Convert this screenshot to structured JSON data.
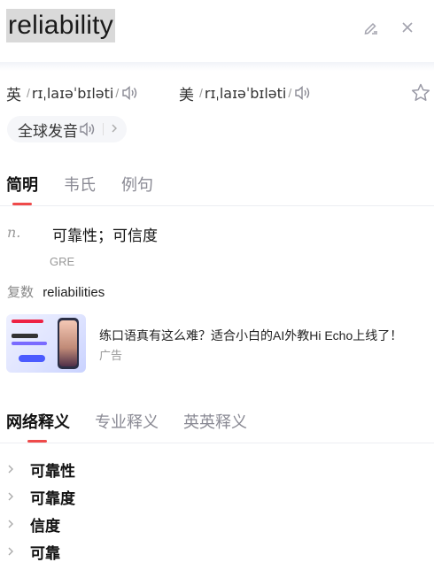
{
  "header": {
    "word": "reliability"
  },
  "phonetics": {
    "uk": {
      "label": "英",
      "ipa": "rɪˌlaɪəˈbɪləti"
    },
    "us": {
      "label": "美",
      "ipa": "rɪˌlaɪəˈbɪləti"
    },
    "global_label": "全球发音"
  },
  "tabs_primary": [
    "简明",
    "韦氏",
    "例句"
  ],
  "definition": {
    "pos": "n.",
    "meaning": "可靠性；可信度",
    "tag": "GRE",
    "plural_label": "复数",
    "plural_value": "reliabilities"
  },
  "ad": {
    "title": "练口语真有这么难？适合小白的AI外教Hi Echo上线了！",
    "label": "广告"
  },
  "tabs_secondary": [
    "网络释义",
    "专业释义",
    "英英释义"
  ],
  "net_definitions": [
    "可靠性",
    "可靠度",
    "信度",
    "可靠"
  ],
  "colors": {
    "accent": "#ef4a4a",
    "muted": "#8a8a94"
  }
}
